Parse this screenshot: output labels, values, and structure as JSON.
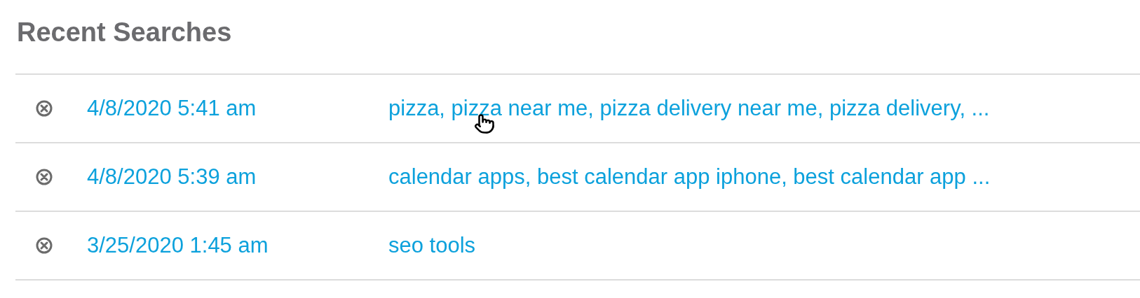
{
  "title": "Recent Searches",
  "searches": [
    {
      "date": "4/8/2020 5:41 am",
      "keywords": "pizza, pizza near me, pizza delivery near me, pizza delivery, ...",
      "hovered": true
    },
    {
      "date": "4/8/2020 5:39 am",
      "keywords": "calendar apps, best calendar app iphone, best calendar app ...",
      "hovered": false
    },
    {
      "date": "3/25/2020 1:45 am",
      "keywords": "seo tools",
      "hovered": false
    }
  ]
}
